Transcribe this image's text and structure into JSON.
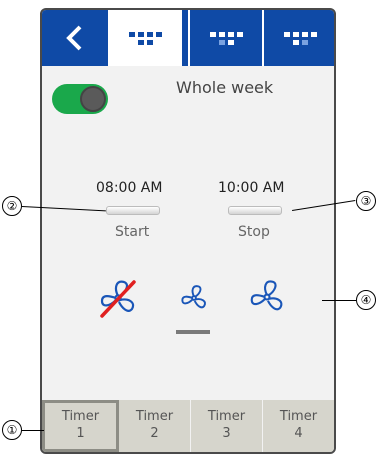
{
  "header": {
    "back_icon": "chevron-left-icon",
    "tabs": [
      "schedule-tab-1",
      "schedule-tab-2",
      "schedule-tab-3"
    ]
  },
  "schedule": {
    "enabled": true,
    "days_label": "Whole week"
  },
  "start": {
    "time": "08:00 AM",
    "label": "Start"
  },
  "stop": {
    "time": "10:00 AM",
    "label": "Stop"
  },
  "fan_modes": [
    "fan-off-icon",
    "fan-low-icon",
    "fan-high-icon"
  ],
  "selected_fan_mode": 1,
  "timers": [
    {
      "line1": "Timer",
      "line2": "1"
    },
    {
      "line1": "Timer",
      "line2": "2"
    },
    {
      "line1": "Timer",
      "line2": "3"
    },
    {
      "line1": "Timer",
      "line2": "4"
    }
  ],
  "callouts": [
    "①",
    "②",
    "③",
    "④"
  ],
  "colors": {
    "accent": "#0f4aa6",
    "toggle_on": "#1aa84b",
    "fan_icon": "#1a56b8",
    "off_slash": "#e02020"
  }
}
